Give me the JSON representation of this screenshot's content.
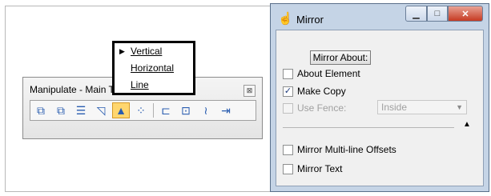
{
  "toolbar": {
    "title": "Manipulate - Main Task",
    "close_glyph": "⊠",
    "icons": [
      "copy-element-icon",
      "move-element-icon",
      "move-parallel-icon",
      "scale-icon",
      "mirror-icon",
      "array-icon",
      "align-edges-icon",
      "stretch-icon",
      "rotate-icon",
      "spin-icon"
    ]
  },
  "dialog": {
    "title": "Mirror",
    "mirror_about_label": "Mirror About:",
    "about_element_label": "About Element",
    "make_copy_label": "Make Copy",
    "make_copy_checked": true,
    "use_fence_label": "Use Fence:",
    "fence_mode": "Inside",
    "mirror_multiline_label": "Mirror Multi-line Offsets",
    "mirror_text_label": "Mirror Text"
  },
  "menu": {
    "items": [
      "Vertical",
      "Horizontal",
      "Line"
    ],
    "selected": "Vertical"
  }
}
